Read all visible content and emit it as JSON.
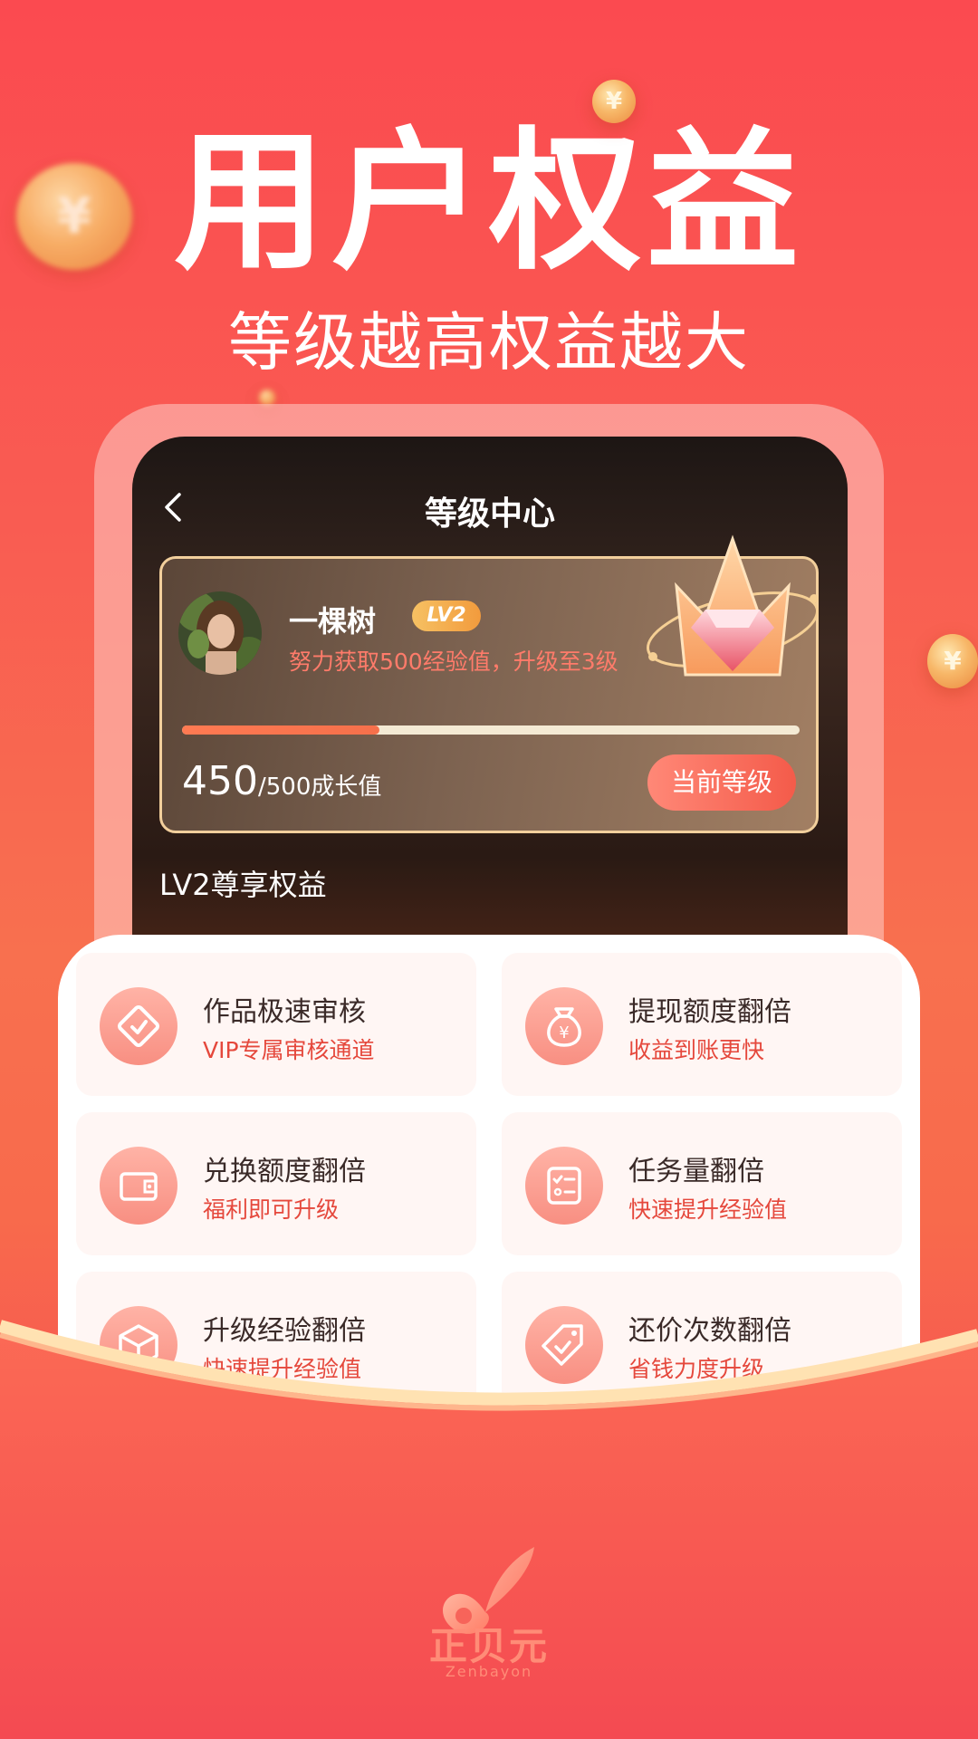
{
  "hero": {
    "title": "用户权益",
    "subtitle": "等级越高权益越大"
  },
  "coins": {
    "symbol": "¥"
  },
  "level_center": {
    "title": "等级中心",
    "user": {
      "name": "一棵树",
      "level_badge": "LV2",
      "hint": "努力获取500经验值，升级至3级"
    },
    "progress": {
      "current": "450",
      "suffix": "/500成长值",
      "fraction": 0.32
    },
    "level_button": "当前等级",
    "perks_heading": "LV2尊享权益"
  },
  "perks": [
    {
      "title": "作品极速审核",
      "subtitle": "VIP专属审核通道",
      "icon": "diamond-icon"
    },
    {
      "title": "提现额度翻倍",
      "subtitle": "收益到账更快",
      "icon": "money-bag-icon"
    },
    {
      "title": "兑换额度翻倍",
      "subtitle": "福利即可升级",
      "icon": "wallet-icon"
    },
    {
      "title": "任务量翻倍",
      "subtitle": "快速提升经验值",
      "icon": "checklist-icon"
    },
    {
      "title": "升级经验翻倍",
      "subtitle": "快速提升经验值",
      "icon": "box-icon"
    },
    {
      "title": "还价次数翻倍",
      "subtitle": "省钱力度升级",
      "icon": "price-tag-icon"
    }
  ],
  "brand": {
    "name": "正贝元",
    "latin": "Zenbayon"
  },
  "colors": {
    "background": "#f95c52",
    "accent": "#e5483c",
    "badge": "#f6c163",
    "card_border": "#f2cf9c"
  }
}
